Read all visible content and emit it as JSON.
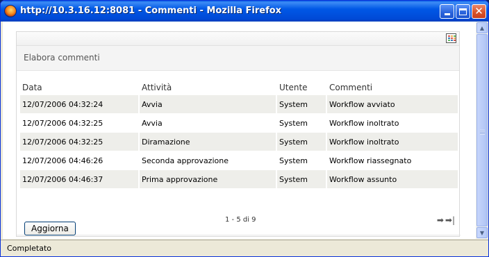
{
  "window": {
    "title": "http://10.3.16.12:8081 - Commenti - Mozilla Firefox"
  },
  "panel": {
    "heading": "Elabora commenti"
  },
  "table": {
    "columns": [
      "Data",
      "Attività",
      "Utente",
      "Commenti"
    ],
    "rows": [
      [
        "12/07/2006 04:32:24",
        "Avvia",
        "System",
        "Workflow avviato"
      ],
      [
        "12/07/2006 04:32:25",
        "Avvia",
        "System",
        "Workflow inoltrato"
      ],
      [
        "12/07/2006 04:32:25",
        "Diramazione",
        "System",
        "Workflow inoltrato"
      ],
      [
        "12/07/2006 04:46:26",
        "Seconda approvazione",
        "System",
        "Workflow riassegnato"
      ],
      [
        "12/07/2006 04:46:37",
        "Prima approvazione",
        "System",
        "Workflow assunto"
      ]
    ]
  },
  "pager": {
    "text": "1 - 5 di 9"
  },
  "buttons": {
    "refresh": "Aggiorna"
  },
  "status": {
    "text": "Completato"
  },
  "icons": {
    "app": "firefox-icon",
    "minimize": "minimize-icon",
    "maximize": "maximize-icon",
    "close": "close-icon",
    "options": "grid-options-icon",
    "next": "next-page-icon",
    "last": "last-page-icon"
  },
  "colors": {
    "titlebar": "#0058e6",
    "row_alt": "#eeeeea",
    "panel_heading_bg": "#f4f4f4"
  }
}
